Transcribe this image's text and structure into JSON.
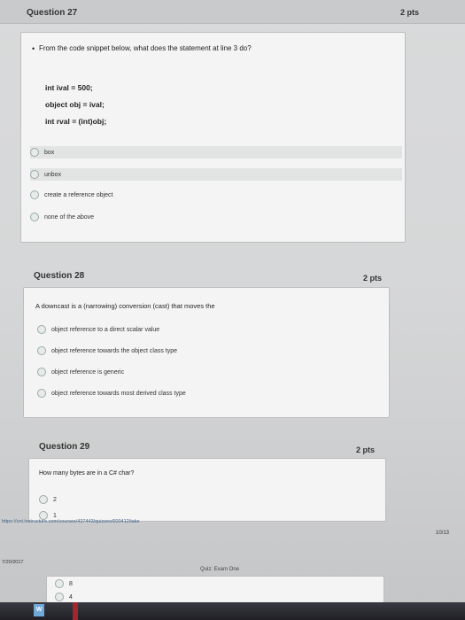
{
  "questions": [
    {
      "title": "Question 27",
      "points": "2 pts",
      "prompt": "From the code snippet below, what does the statement at line 3 do?",
      "code": [
        "int ival = 500;",
        "object obj = ival;",
        "int rval = (int)obj;"
      ],
      "options": [
        "box",
        "unbox",
        "create a reference object",
        "none of the above"
      ]
    },
    {
      "title": "Question 28",
      "points": "2 pts",
      "prompt": "A downcast is a (narrowing) conversion (cast) that moves the",
      "options": [
        "object reference to a direct scalar value",
        "object reference towards the object class type",
        "object reference is generic",
        "object reference towards most derived class type"
      ]
    },
    {
      "title": "Question 29",
      "points": "2 pts",
      "prompt": "How many bytes are in a C# char?",
      "options": [
        "2",
        "1",
        "8",
        "4"
      ]
    }
  ],
  "footer": {
    "url": "https://uni.instructure.com/courses/437443/quizzes/600412/take",
    "date": "7/20/2017",
    "page_title": "Quiz: Exam One",
    "pager": "10/13"
  },
  "taskbar": {
    "start_label": "W"
  },
  "colors": {
    "background": "#d6d7d8",
    "card": "#f4f4f4",
    "taskbar": "#1f1f25"
  }
}
